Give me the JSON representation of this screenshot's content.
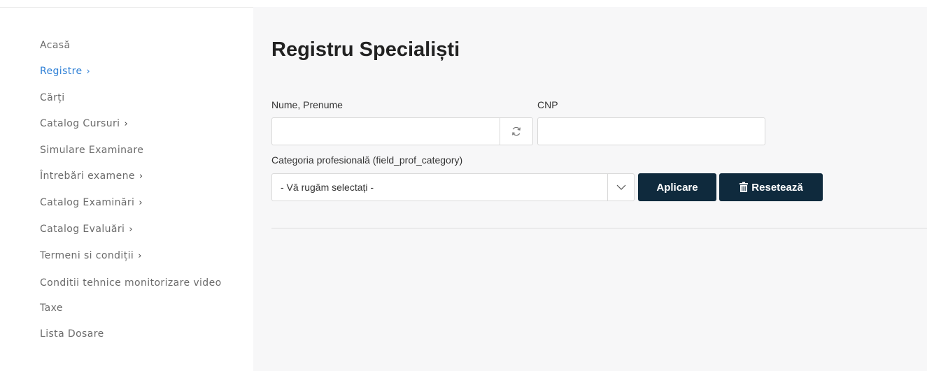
{
  "sidebar": {
    "items": [
      {
        "label": "Acasă",
        "chevron": ""
      },
      {
        "label": "Registre",
        "chevron": "›"
      },
      {
        "label": "Cărți",
        "chevron": ""
      },
      {
        "label": "Catalog Cursuri",
        "chevron": "›"
      },
      {
        "label": "Simulare Examinare",
        "chevron": ""
      },
      {
        "label": "Întrebări examene",
        "chevron": "›"
      },
      {
        "label": "Catalog Examinări",
        "chevron": "›"
      },
      {
        "label": "Catalog Evaluări",
        "chevron": "›"
      },
      {
        "label": "Termeni si condiții",
        "chevron": "›"
      },
      {
        "label": "Conditii tehnice monitorizare video",
        "chevron": ""
      },
      {
        "label": "Taxe",
        "chevron": ""
      },
      {
        "label": "Lista Dosare",
        "chevron": ""
      }
    ],
    "active_index": 1,
    "active_color": "#2f80d6"
  },
  "main": {
    "title": "Registru Specialiști",
    "filters": {
      "name_label": "Nume, Prenume",
      "name_value": "",
      "cnp_label": "CNP",
      "cnp_value": "",
      "category_label": "Categoria profesională (field_prof_category)",
      "category_selected": "- Vă rugăm selectați -"
    },
    "buttons": {
      "apply": "Aplicare",
      "reset": "Resetează",
      "color": "#0f2a3d"
    },
    "icons": {
      "refresh": "refresh-icon",
      "dropdown": "chevron-down-icon",
      "trash": "trash-icon"
    }
  }
}
